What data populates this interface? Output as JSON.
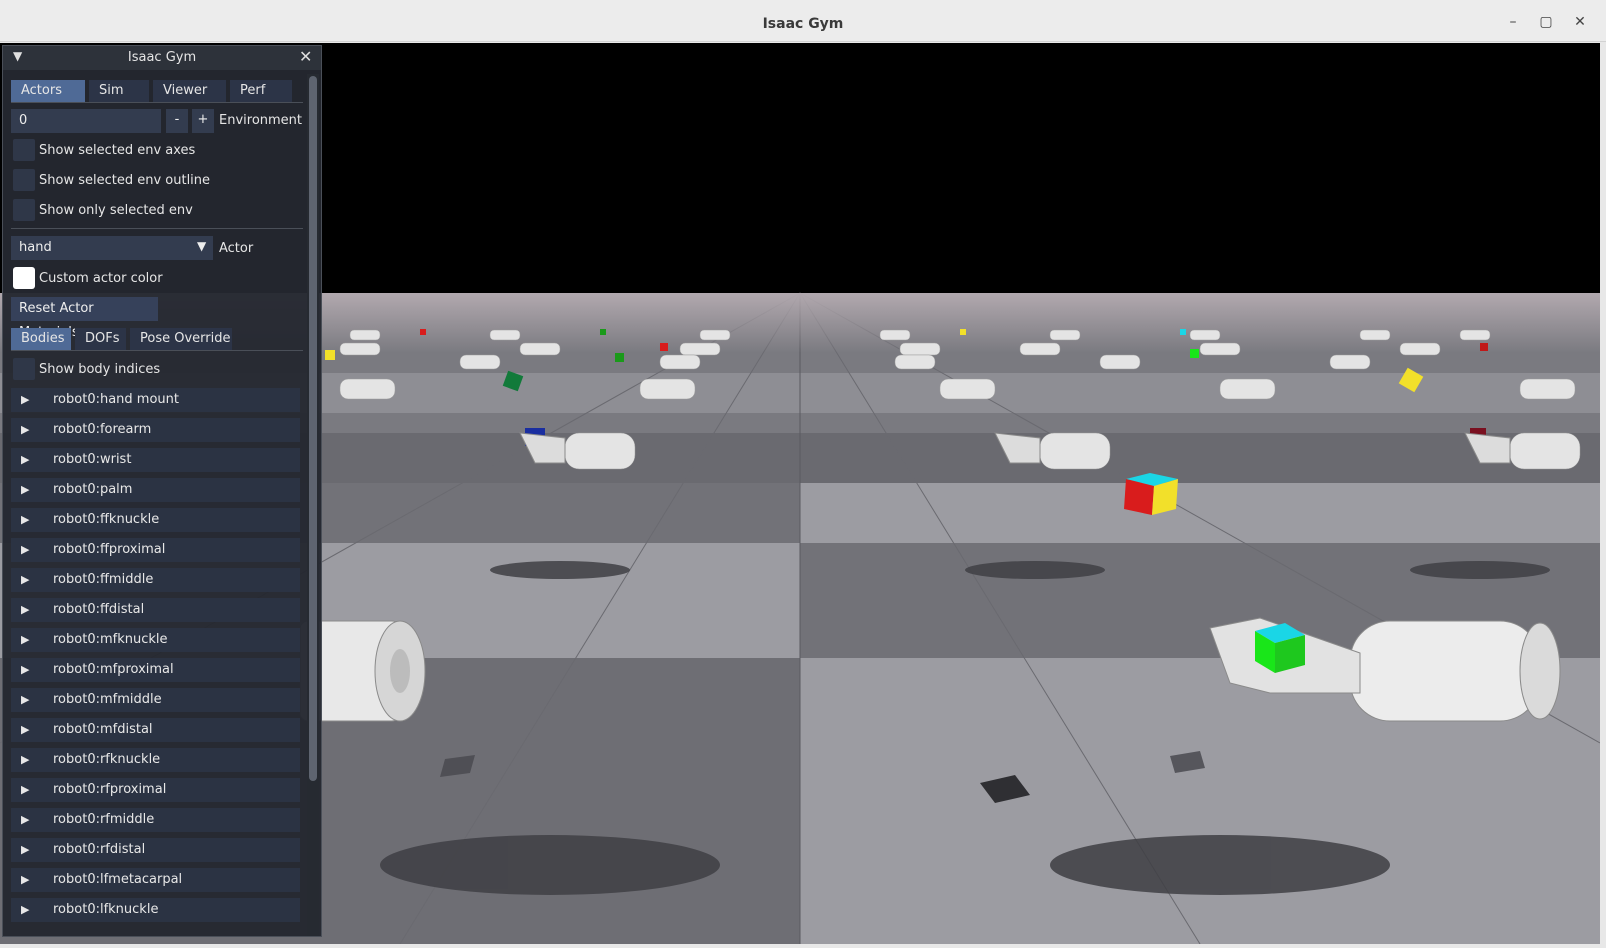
{
  "window": {
    "title": "Isaac Gym",
    "controls": {
      "minimize": "–",
      "maximize": "▢",
      "close": "✕"
    }
  },
  "panel": {
    "title": "Isaac Gym",
    "collapse_glyph": "▼",
    "close_glyph": "✕",
    "tabs": [
      "Actors",
      "Sim",
      "Viewer",
      "Perf"
    ],
    "environment": {
      "value": "0",
      "minus": "-",
      "plus": "+",
      "label": "Environment"
    },
    "checkboxes": [
      "Show selected env axes",
      "Show selected env outline",
      "Show only selected env"
    ],
    "actor": {
      "value": "hand",
      "label": "Actor",
      "dropdown_glyph": "▼"
    },
    "custom_actor_color": "Custom actor color",
    "reset_button": "Reset Actor Materials",
    "subtabs": [
      "Bodies",
      "DOFs",
      "Pose Override"
    ],
    "show_body_indices": "Show body indices",
    "expand_glyph": "▶",
    "bodies": [
      "robot0:hand mount",
      "robot0:forearm",
      "robot0:wrist",
      "robot0:palm",
      "robot0:ffknuckle",
      "robot0:ffproximal",
      "robot0:ffmiddle",
      "robot0:ffdistal",
      "robot0:mfknuckle",
      "robot0:mfproximal",
      "robot0:mfmiddle",
      "robot0:mfdistal",
      "robot0:rfknuckle",
      "robot0:rfproximal",
      "robot0:rfmiddle",
      "robot0:rfdistal",
      "robot0:lfmetacarpal",
      "robot0:lfknuckle"
    ]
  },
  "colors": {
    "panel_bg": "#242830",
    "tab_active": "#4f6a96",
    "tab_inactive": "#2c3447",
    "sky": "#000000",
    "floor_light": "#9a9aa0",
    "floor_dark": "#6f6f74",
    "cube_green": "#19e619",
    "cube_cyan": "#1ad6e6",
    "cube_red": "#d91c1c",
    "cube_yellow": "#f2e02a"
  }
}
